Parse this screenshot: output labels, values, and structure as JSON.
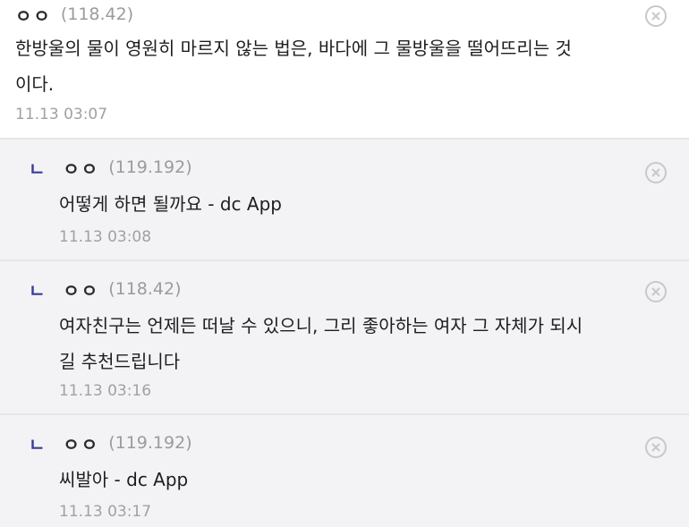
{
  "comments": [
    {
      "nickname": "ㅇㅇ",
      "ip": "(118.42)",
      "text_line1": "한방울의 물이 영원히 마르지 않는 법은, 바다에 그 물방울을 떨어뜨리는 것",
      "text_line2": "이다.",
      "date": "11.13 03:07",
      "is_reply": false
    },
    {
      "reply_mark": "ㄴ",
      "nickname": "ㅇㅇ",
      "ip": "(119.192)",
      "text_line1": "어떻게 하면 될까요 - dc App",
      "date": "11.13 03:08",
      "is_reply": true
    },
    {
      "reply_mark": "ㄴ",
      "nickname": "ㅇㅇ",
      "ip": "(118.42)",
      "text_line1": "여자친구는 언제든 떠날 수 있으니, 그리 좋아하는 여자 그 자체가 되시",
      "text_line2": "길 추천드립니다",
      "date": "11.13 03:16",
      "is_reply": true
    },
    {
      "reply_mark": "ㄴ",
      "nickname": "ㅇㅇ",
      "ip": "(119.192)",
      "text_line1": "씨발아 - dc App",
      "date": "11.13 03:17",
      "is_reply": true
    }
  ],
  "icons": {
    "delete": "close-circle-icon"
  },
  "colors": {
    "reply_bg": "#f3f3f5",
    "reply_mark": "#3a3a9a",
    "meta_text": "#9a9aa0"
  }
}
